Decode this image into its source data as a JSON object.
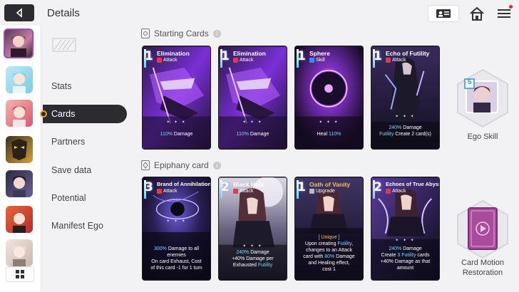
{
  "header": {
    "title": "Details"
  },
  "nav": {
    "items": [
      {
        "label": "Stats"
      },
      {
        "label": "Cards"
      },
      {
        "label": "Partners"
      },
      {
        "label": "Save data"
      },
      {
        "label": "Potential"
      },
      {
        "label": "Manifest Ego"
      }
    ],
    "active": "Cards"
  },
  "sections": {
    "starting": "Starting Cards",
    "epiphany": "Epiphany card"
  },
  "starting_cards": [
    {
      "cost": "1",
      "name": "Elimination",
      "type": "Attack",
      "desc_pct": "110%",
      "desc_rest": " Damage"
    },
    {
      "cost": "1",
      "name": "Elimination",
      "type": "Attack",
      "desc_pct": "110%",
      "desc_rest": " Damage"
    },
    {
      "cost": "1",
      "name": "Sphere",
      "type": "Skill",
      "desc_pre": "Heal ",
      "desc_pct": "110%",
      "desc_rest": ""
    },
    {
      "cost": "1",
      "name": "Echo of Futility",
      "type": "Attack",
      "line1_pct": "240%",
      "line1_rest": " Damage",
      "line2_hl": "Futility",
      "line2_rest": " Create 2 card(s)"
    }
  ],
  "epiphany_cards": [
    {
      "cost": "3",
      "name": "Brand of Annihilation",
      "type": "Attack",
      "l1_pct": "300%",
      "l1_rest": " Damage to all",
      "l2": "enemies",
      "l3": "On card Exhaust, Cost",
      "l4": "of this card -1 for 1 turn"
    },
    {
      "cost": "2",
      "name": "Black Hole",
      "type": "Attack",
      "l1_pct": "240%",
      "l1_rest": " Damage",
      "l2": "+40% Damage per",
      "l3_pre": "Exhausted ",
      "l3_hl": "Futility"
    },
    {
      "cost": "1",
      "name": "Oath of Vanity",
      "type": "Upgrade",
      "tag": "[ Unique ]",
      "l1_pre": "Upon creating ",
      "l1_hl": "Futility",
      "l1_post": ",",
      "l2": "changes to an Attack",
      "l3_pre": "card with ",
      "l3_hl": "80%",
      "l3_post": " Damage",
      "l4": "and Healing effect,",
      "l5": "cost 1"
    },
    {
      "cost": "2",
      "name": "Echoes of True Abyss",
      "type": "Attack",
      "l1_pct": "240%",
      "l1_rest": " Damage",
      "l2_pre": "Create ",
      "l2_hl": "3 Futility",
      "l2_post": " cards",
      "l3": "+40% Damage as that",
      "l4": "amount"
    }
  ],
  "ego_skill": {
    "label": "Ego Skill",
    "level": "5"
  },
  "card_motion": {
    "label_line1": "Card Motion",
    "label_line2": "Restoration"
  },
  "colors": {
    "accent": "#a04bb6",
    "dark": "#2b2b30",
    "highlight": "#7fd3ff",
    "unique": "#f2c14e"
  }
}
